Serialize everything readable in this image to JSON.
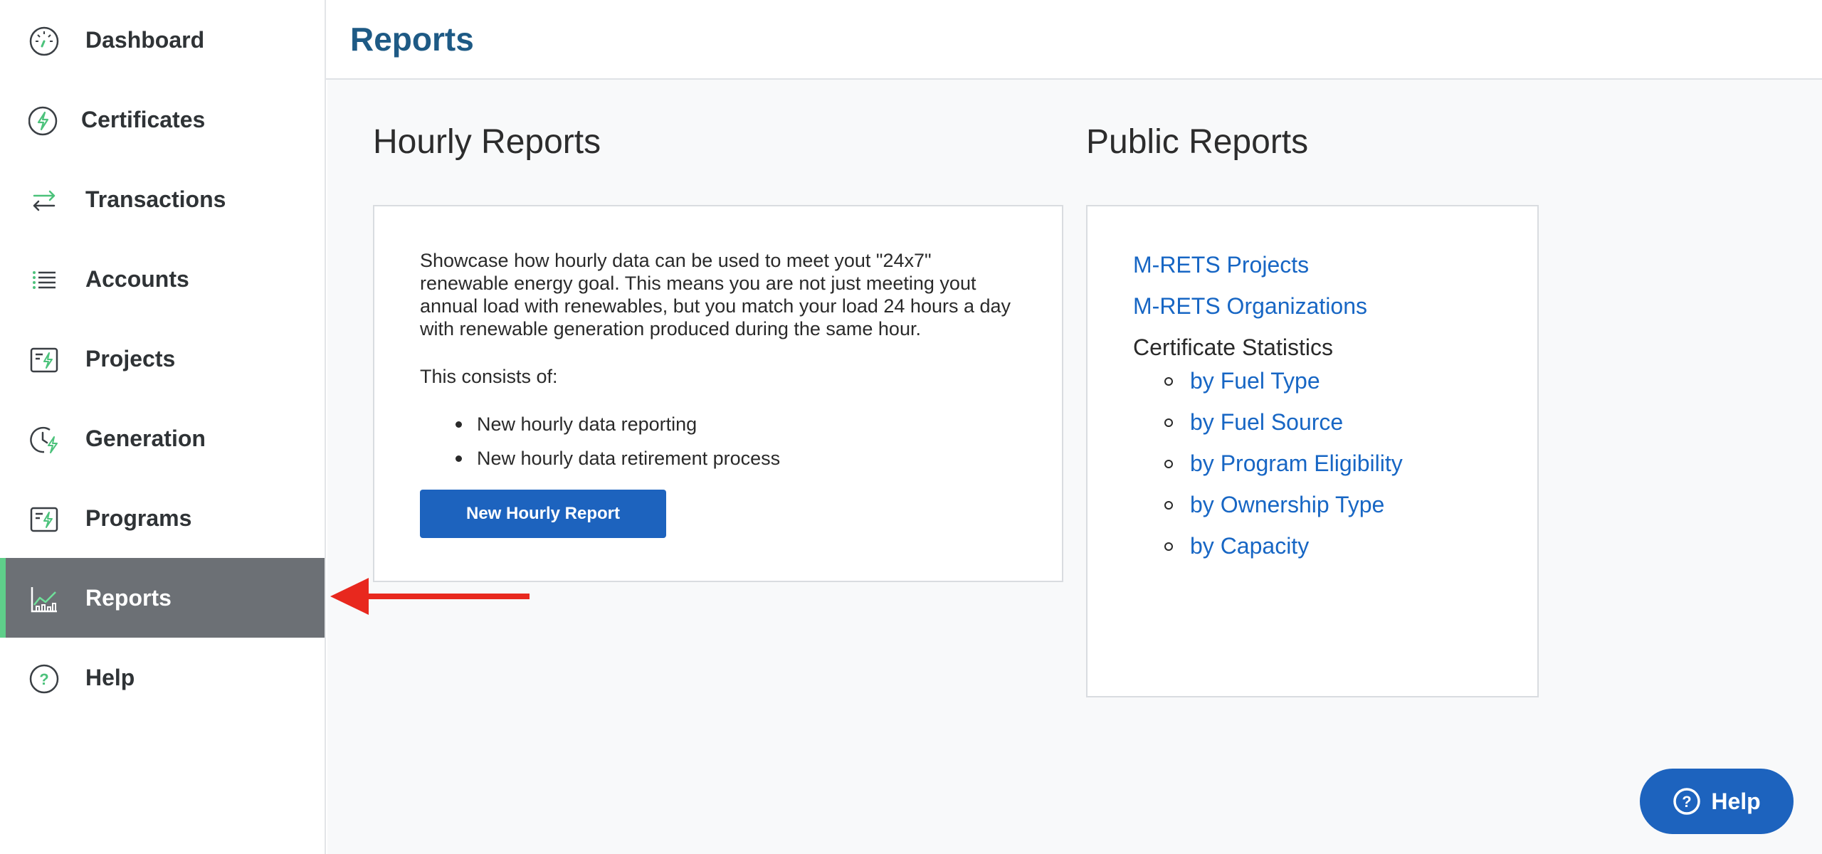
{
  "sidebar": {
    "items": [
      {
        "label": "Dashboard",
        "icon": "dashboard-gauge-icon"
      },
      {
        "label": "Certificates",
        "icon": "certificate-bolt-icon"
      },
      {
        "label": "Transactions",
        "icon": "transfer-arrows-icon"
      },
      {
        "label": "Accounts",
        "icon": "list-icon"
      },
      {
        "label": "Projects",
        "icon": "project-card-icon"
      },
      {
        "label": "Generation",
        "icon": "clock-bolt-icon"
      },
      {
        "label": "Programs",
        "icon": "program-card-icon"
      },
      {
        "label": "Reports",
        "icon": "chart-icon",
        "active": true
      },
      {
        "label": "Help",
        "icon": "question-circle-icon"
      }
    ]
  },
  "header": {
    "title": "Reports"
  },
  "hourly": {
    "title": "Hourly Reports",
    "description": "Showcase how hourly data can be used to meet yout \"24x7\" renewable energy goal. This means you are not just meeting yout annual load with renewables, but you match your load 24 hours a day with renewable generation produced during the same hour.",
    "consists": "This consists of:",
    "bullets": [
      "New hourly data reporting",
      "New hourly data retirement process"
    ],
    "button_label": "New Hourly Report"
  },
  "public": {
    "title": "Public Reports",
    "links": [
      "M-RETS Projects",
      "M-RETS Organizations"
    ],
    "stats_heading": "Certificate Statistics",
    "stats_links": [
      "by Fuel Type",
      "by Fuel Source",
      "by Program Eligibility",
      "by Ownership Type",
      "by Capacity"
    ]
  },
  "help_button": {
    "label": "Help"
  },
  "colors": {
    "accent": "#1d63be",
    "link": "#1766c4",
    "title": "#1e5a85",
    "active_nav_bg": "#6c7075",
    "active_indicator": "#5fcf8a",
    "annotation_arrow": "#e8281e"
  }
}
